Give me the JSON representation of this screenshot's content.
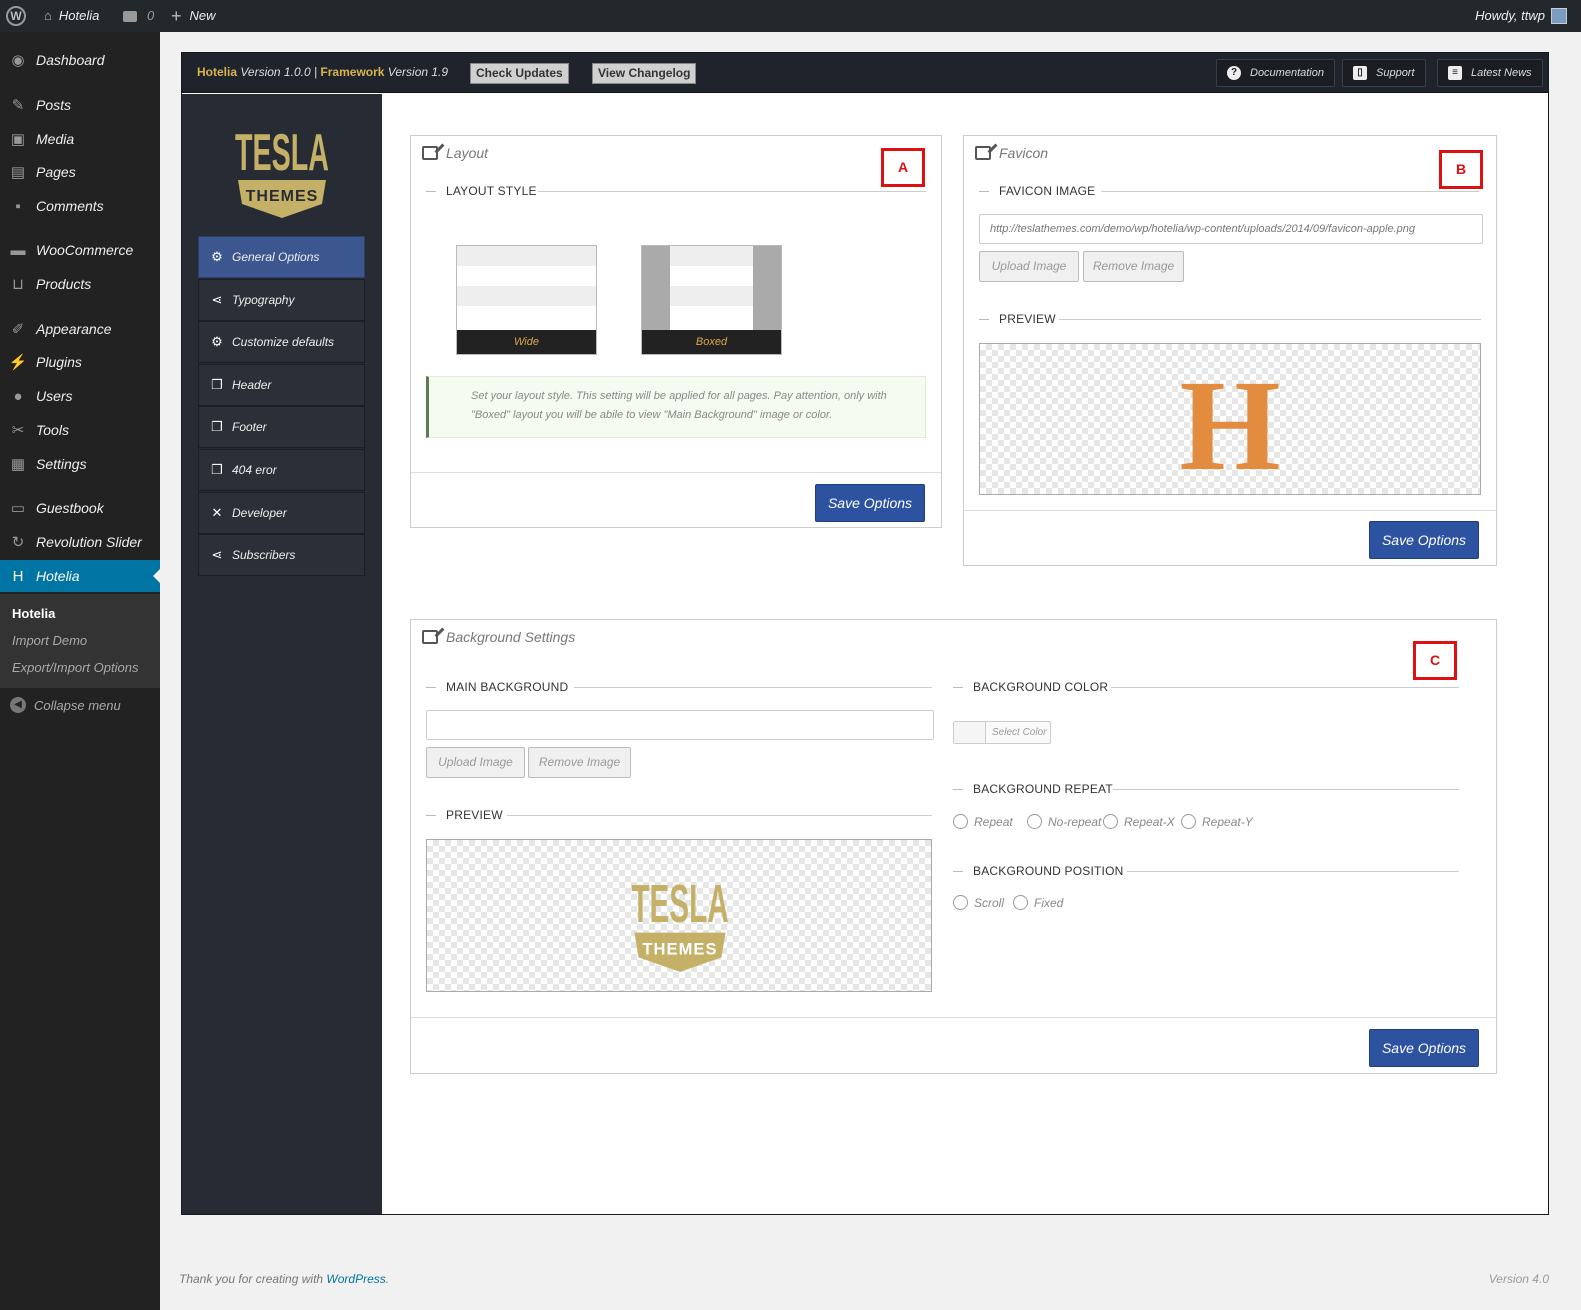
{
  "adminbar": {
    "site_name": "Hotelia",
    "comments_count": "0",
    "new_label": "New",
    "greeting": "Howdy, ttwp"
  },
  "admin_menu": {
    "items": [
      {
        "label": "Dashboard",
        "icon": "dashboard-icon"
      },
      {
        "label": "Posts",
        "icon": "pin-icon"
      },
      {
        "label": "Media",
        "icon": "media-icon"
      },
      {
        "label": "Pages",
        "icon": "pages-icon"
      },
      {
        "label": "Comments",
        "icon": "comment-icon"
      },
      {
        "label": "WooCommerce",
        "icon": "woo-icon"
      },
      {
        "label": "Products",
        "icon": "cart-icon"
      },
      {
        "label": "Appearance",
        "icon": "brush-icon"
      },
      {
        "label": "Plugins",
        "icon": "plug-icon"
      },
      {
        "label": "Users",
        "icon": "user-icon"
      },
      {
        "label": "Tools",
        "icon": "wrench-icon"
      },
      {
        "label": "Settings",
        "icon": "settings-icon"
      },
      {
        "label": "Guestbook",
        "icon": "briefcase-icon"
      },
      {
        "label": "Revolution Slider",
        "icon": "refresh-icon"
      },
      {
        "label": "Hotelia",
        "icon": "hotelia-icon"
      }
    ],
    "submenu": [
      "Hotelia",
      "Import Demo",
      "Export/Import Options"
    ],
    "collapse_label": "Collapse menu"
  },
  "panel": {
    "theme_name": "Hotelia",
    "theme_version": "Version 1.0.0 |",
    "framework_name": "Framework",
    "framework_version": "Version 1.9",
    "check_updates": "Check Updates",
    "view_changelog": "View Changelog",
    "documentation": "Documentation",
    "support": "Support",
    "latest_news": "Latest News",
    "logo_text_top": "TESLA",
    "logo_text_bottom": "THEMES",
    "nav": [
      {
        "label": "General Options",
        "icon": "gear-icon"
      },
      {
        "label": "Typography",
        "icon": "share-icon"
      },
      {
        "label": "Customize defaults",
        "icon": "gear-icon"
      },
      {
        "label": "Header",
        "icon": "copy-icon"
      },
      {
        "label": "Footer",
        "icon": "copy-icon"
      },
      {
        "label": "404 eror",
        "icon": "copy-icon"
      },
      {
        "label": "Developer",
        "icon": "tools-icon"
      },
      {
        "label": "Subscribers",
        "icon": "share-icon"
      }
    ]
  },
  "layout_box": {
    "title": "Layout",
    "section": "LAYOUT STYLE",
    "wide_label": "Wide",
    "boxed_label": "Boxed",
    "note": "Set your layout style. This setting will be applied for all pages. Pay attention, only with \"Boxed\" layout you will be abile to view \"Main Background\" image or color.",
    "save": "Save Options",
    "marker": "A"
  },
  "favicon_box": {
    "title": "Favicon",
    "section": "FAVICON IMAGE",
    "url": "http://teslathemes.com/demo/wp/hotelia/wp-content/uploads/2014/09/favicon-apple.png",
    "upload": "Upload Image",
    "remove": "Remove Image",
    "preview": "PREVIEW",
    "preview_letter": "H",
    "save": "Save Options",
    "marker": "B"
  },
  "background_box": {
    "title": "Background Settings",
    "main_bg": "MAIN BACKGROUND",
    "main_bg_value": "",
    "upload": "Upload Image",
    "remove": "Remove Image",
    "preview": "PREVIEW",
    "bg_color": "BACKGROUND COLOR",
    "select_color": "Select Color",
    "bg_repeat": "BACKGROUND REPEAT",
    "repeat_options": [
      "Repeat",
      "No-repeat",
      "Repeat-X",
      "Repeat-Y"
    ],
    "bg_position": "BACKGROUND POSITION",
    "position_options": [
      "Scroll",
      "Fixed"
    ],
    "save": "Save Options",
    "marker": "C"
  },
  "footer": {
    "thanks": "Thank you for creating with",
    "link": "WordPress",
    "period": ".",
    "version": "Version 4.0"
  },
  "colors": {
    "admin_bar": "#23282d",
    "admin_menu": "#222222",
    "menu_current": "#0074a2",
    "panel_dark": "#272c34",
    "nav_active": "#3c5690",
    "save_button": "#2d52a0",
    "accent_gold": "#c5b068",
    "favicon_orange": "#e38b3f",
    "marker_red": "#dd1111"
  }
}
